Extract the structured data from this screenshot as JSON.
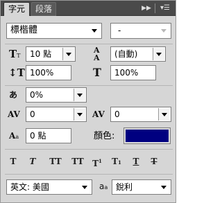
{
  "tabs": [
    {
      "label": "字元",
      "active": true
    },
    {
      "label": "段落",
      "active": false
    }
  ],
  "font_family": {
    "value": "標楷體"
  },
  "font_style": {
    "value": "-"
  },
  "font_size": {
    "value": "10 點"
  },
  "leading": {
    "value": "(自動)"
  },
  "vertical_scale": {
    "value": "100%"
  },
  "horizontal_scale": {
    "value": "100%"
  },
  "tsume": {
    "value": "0%"
  },
  "kerning": {
    "value": "0"
  },
  "tracking": {
    "value": "0"
  },
  "baseline_shift": {
    "value": "0 點"
  },
  "color": {
    "label": "顏色:",
    "swatch": "#000080"
  },
  "style_buttons": [
    {
      "glyph": "T"
    },
    {
      "glyph": "T"
    },
    {
      "glyph": "TT"
    },
    {
      "glyph": "TT"
    },
    {
      "glyph": "T",
      "sup": "1"
    },
    {
      "glyph": "T",
      "sub": "1"
    },
    {
      "glyph": "T"
    },
    {
      "glyph": "T"
    }
  ],
  "language": {
    "value": "英文: 美國"
  },
  "antialias": {
    "icon_text": "a",
    "icon_sub": "a",
    "value": "銳利"
  }
}
